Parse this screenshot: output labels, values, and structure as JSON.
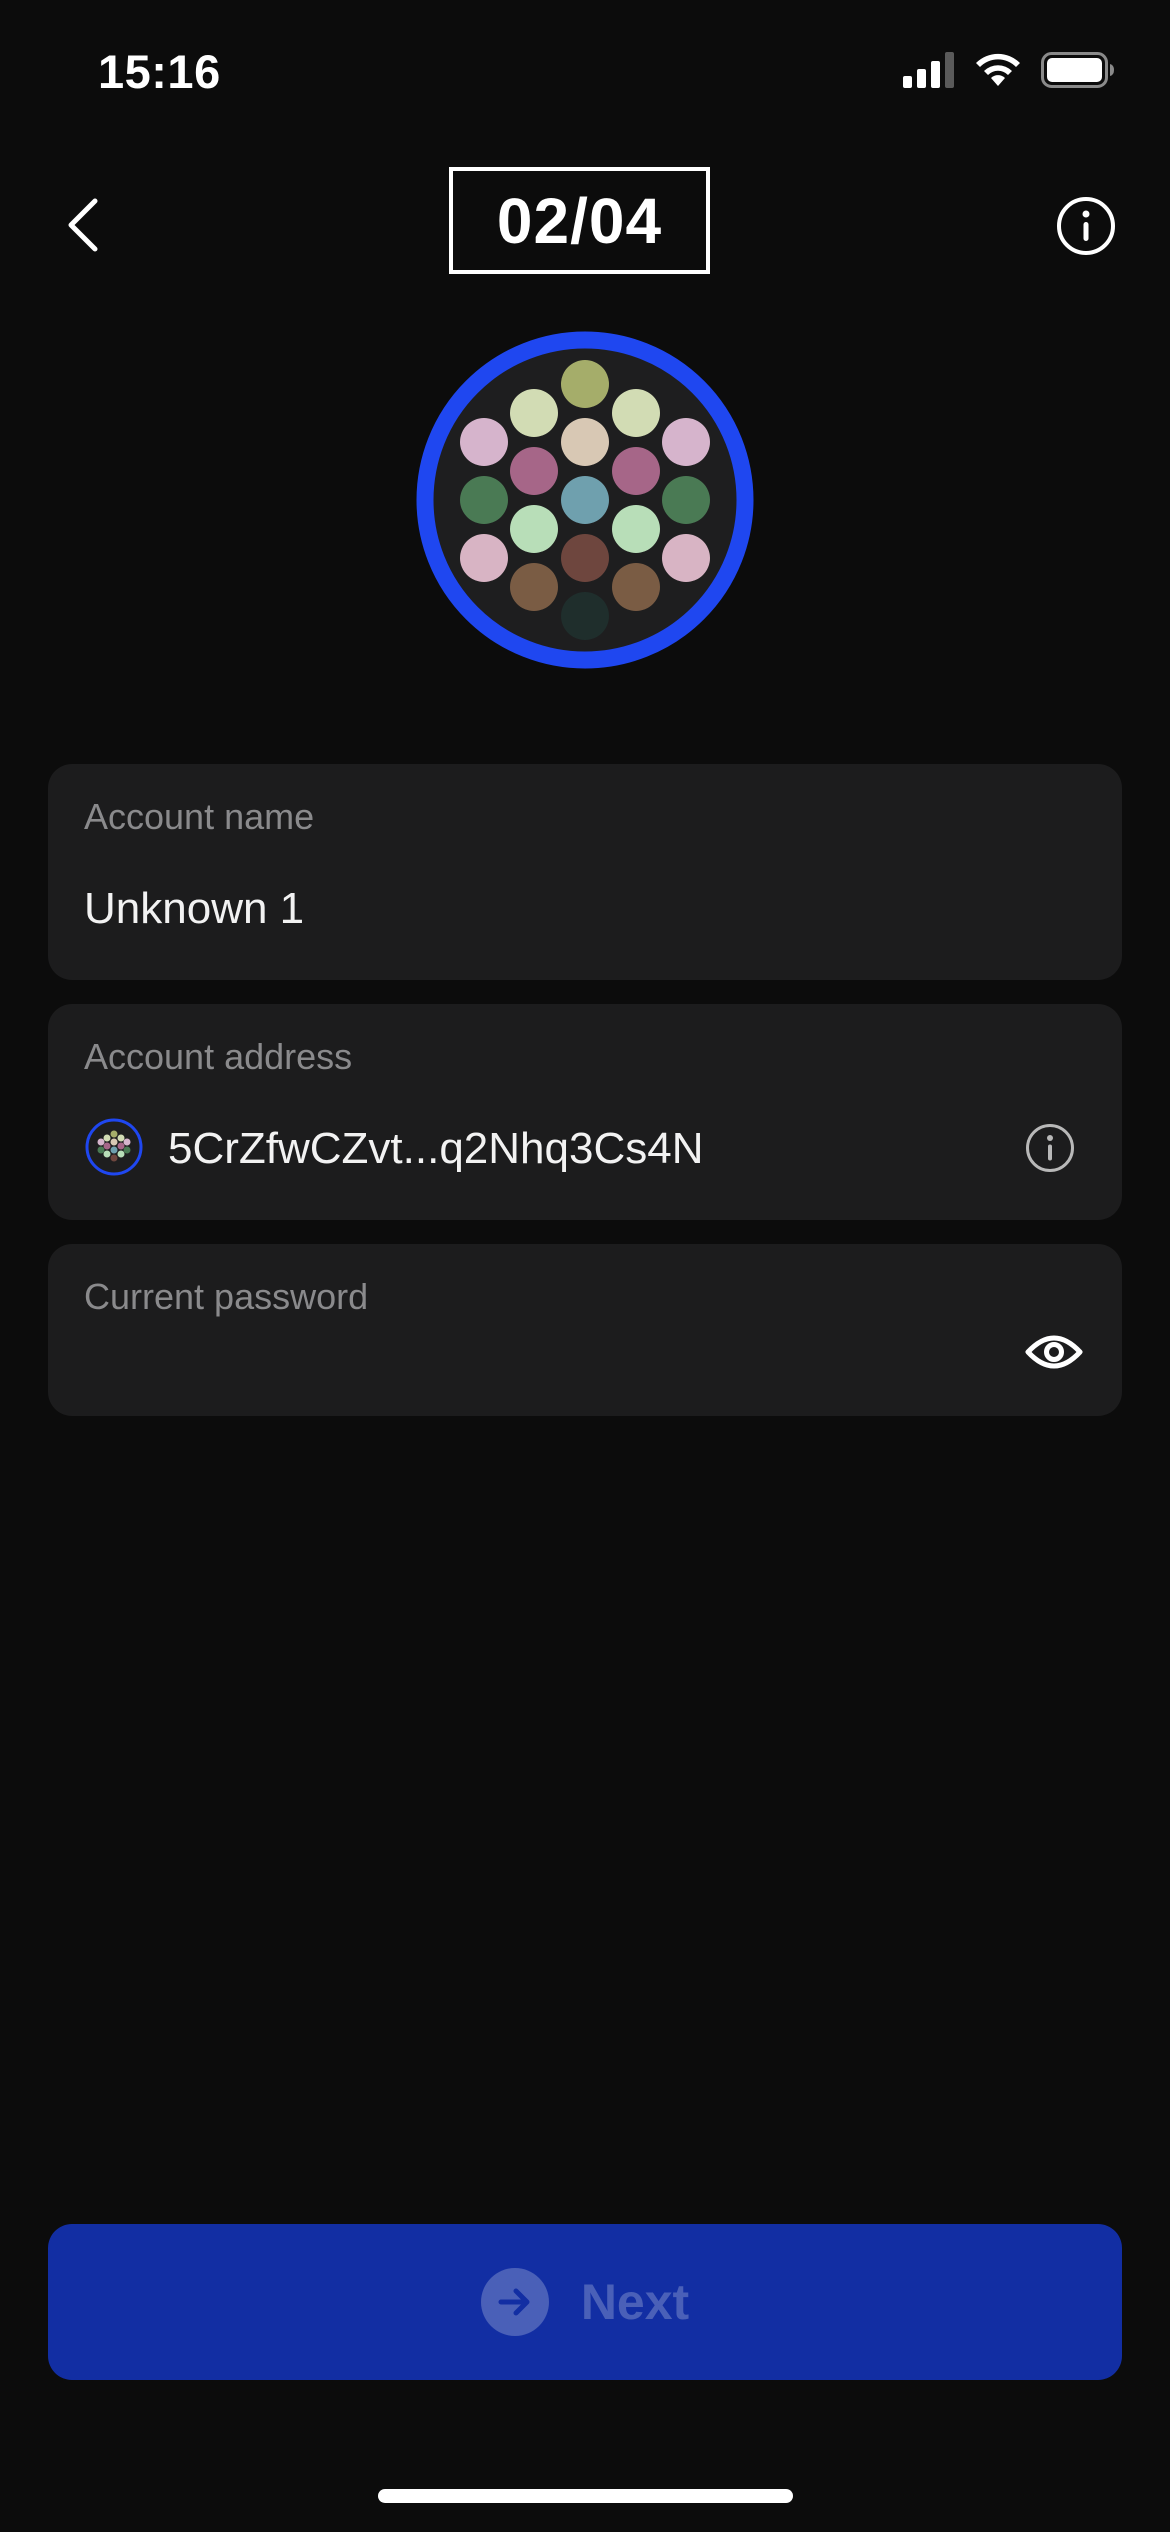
{
  "status_bar": {
    "time": "15:16"
  },
  "header": {
    "step": "02/04"
  },
  "form": {
    "account_name": {
      "label": "Account name",
      "value": "Unknown 1"
    },
    "account_address": {
      "label": "Account address",
      "value": "5CrZfwCZvt...q2Nhq3Cs4N"
    },
    "current_password": {
      "label": "Current password",
      "value": ""
    }
  },
  "footer": {
    "next_label": "Next"
  },
  "icons": {
    "back": "chevron-left-icon",
    "info": "info-icon",
    "eye": "eye-icon",
    "arrow": "arrow-right-icon"
  },
  "colors": {
    "background": "#0c0c0c",
    "card": "#1c1c1d",
    "accent": "#1f47f0",
    "button": "#122ea3"
  }
}
